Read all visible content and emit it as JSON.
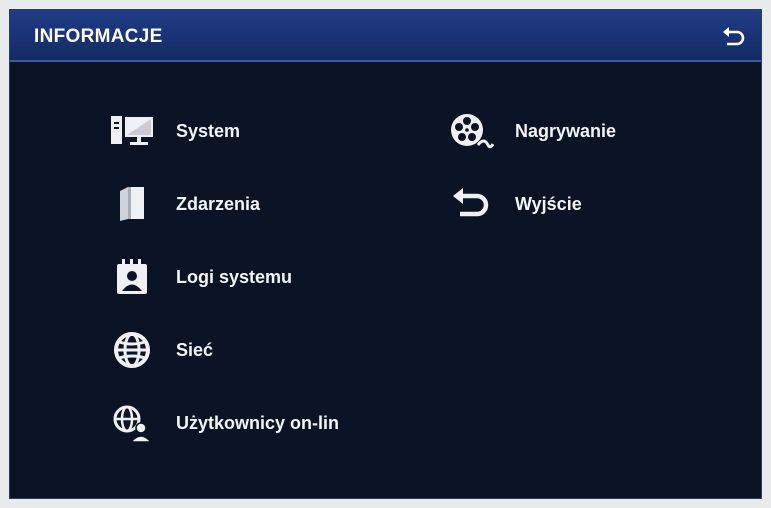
{
  "window": {
    "title": "INFORMACJE",
    "back_icon": "back-arrow-icon"
  },
  "menu": {
    "left": [
      {
        "id": "system",
        "label": "System",
        "icon": "computer-icon"
      },
      {
        "id": "zdarzenia",
        "label": "Zdarzenia",
        "icon": "book-icon"
      },
      {
        "id": "logi",
        "label": "Logi systemu",
        "icon": "log-user-icon"
      },
      {
        "id": "siec",
        "label": "Sieć",
        "icon": "globe-icon"
      },
      {
        "id": "uzytkownicy",
        "label": "Użytkownicy on-lin",
        "icon": "globe-user-icon"
      }
    ],
    "right": [
      {
        "id": "nagrywanie",
        "label": "Nagrywanie",
        "icon": "film-reel-icon"
      },
      {
        "id": "wyjscie",
        "label": "Wyjście",
        "icon": "back-arrow-icon"
      }
    ]
  },
  "colors": {
    "background": "#0b1424",
    "titlebar": "#1a3578",
    "text": "#f2f4f8",
    "icon": "#eef0f4"
  }
}
